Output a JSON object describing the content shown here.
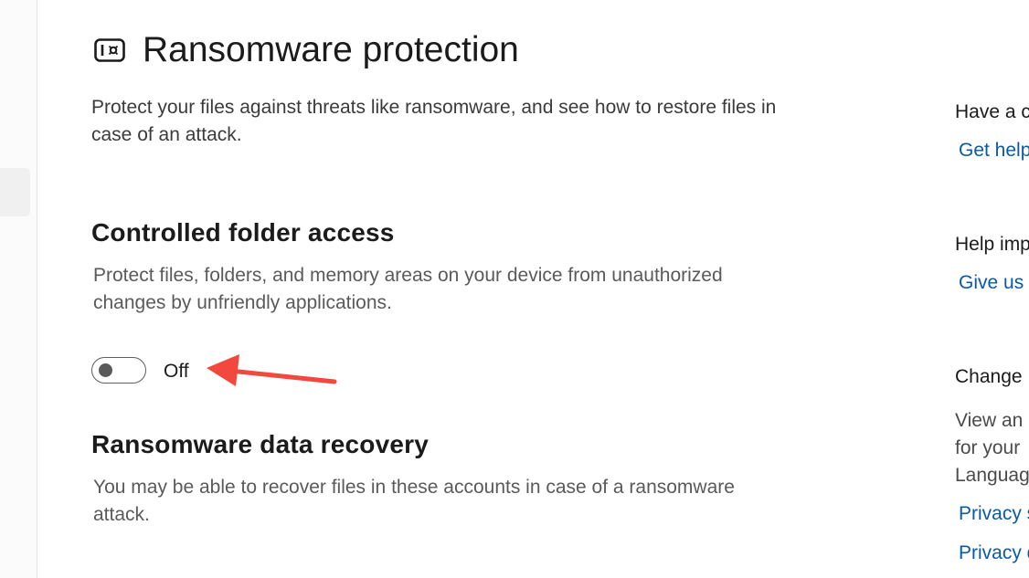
{
  "page": {
    "title": "Ransomware protection",
    "description": "Protect your files against threats like ransomware, and see how to restore files in case of an attack."
  },
  "icons": {
    "page_icon": "ransomware-shield-icon"
  },
  "controlled_folder_access": {
    "title": "Controlled folder access",
    "description": "Protect files, folders, and memory areas on your device from unauthorized changes by unfriendly applications.",
    "toggle_state": "Off",
    "toggle_on": false
  },
  "ransomware_recovery": {
    "title": "Ransomware data recovery",
    "description": "You may be able to recover files in these accounts in case of a ransomware attack."
  },
  "right_panel": {
    "have_question_heading": "Have a c",
    "get_help_link": "Get help",
    "help_improve_heading": "Help imp",
    "give_feedback_link": "Give us f",
    "change_privacy_heading": "Change",
    "privacy_text_line1": "View an",
    "privacy_text_line2": "for your",
    "privacy_text_line3": "Languag",
    "privacy_link_1": "Privacy s",
    "privacy_link_2": "Privacy d"
  },
  "colors": {
    "annotation_arrow": "#f2483e",
    "link": "#0a5aa8",
    "text_primary": "#1b1b1b",
    "text_secondary": "#5a5a5a"
  }
}
